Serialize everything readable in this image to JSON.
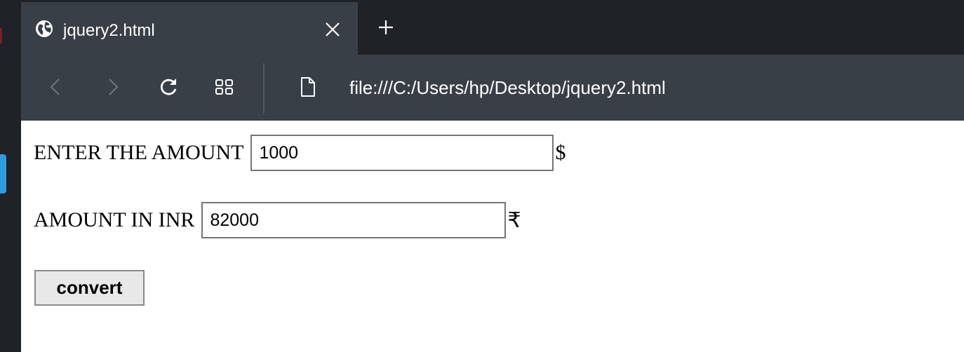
{
  "tab": {
    "title": "jquery2.html",
    "icon": "globe-icon"
  },
  "toolbar": {
    "url": "file:///C:/Users/hp/Desktop/jquery2.html",
    "icons": [
      "back-icon",
      "forward-icon",
      "reload-icon",
      "tabs-grid-icon",
      "page-icon"
    ]
  },
  "form": {
    "amount_label": "ENTER THE AMOUNT",
    "amount_value": "1000",
    "amount_unit": "$",
    "inr_label": "AMOUNT IN INR",
    "inr_value": "82000",
    "inr_unit": "₹",
    "convert_label": "convert"
  },
  "colors": {
    "tab_bar_bg": "#1f2226",
    "active_tab_bg": "#393f47",
    "toolbar_bg": "#393f47"
  }
}
